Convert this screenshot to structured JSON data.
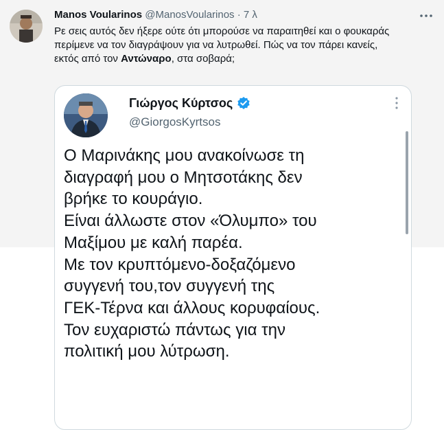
{
  "tweet": {
    "author_name": "Manos Voularinos",
    "handle": "@ManosVoularinos",
    "separator": "·",
    "time": "7 λ",
    "more_icon": "ellipsis-horizontal-icon",
    "text_line1": "Ρε σεις αυτός δεν ήξερε ούτε ότι μπορούσε να παραιτηθεί και ο φουκαράς",
    "text_line2": "περίμενε να τον διαγράψουν για να λυτρωθεί. Πώς να τον πάρει κανείς,",
    "text_line3_pre": "εκτός από τον ",
    "text_line3_bold": "Αντώναρο",
    "text_line3_post": ", στα σοβαρά;"
  },
  "quoted": {
    "name": "Γιώργος Κύρτσος",
    "handle": "@GiorgosKyrtsos",
    "verified_color": "#1d9bf0",
    "lines": [
      "Ο Μαρινάκης μου ανακοίνωσε τη",
      "διαγραφή μου ο Μητσοτάκης δεν",
      "βρήκε το κουράγιο.",
      "Είναι άλλωστε στον «Όλυμπο» του",
      "Μαξίμου με καλή παρέα.",
      "Με τον κρυπτόμενο-δοξαζόμενο",
      "συγγενή του,τον συγγενή της",
      "ΓΕΚ-Τέρνα και άλλους κορυφαίους.",
      "Τον ευχαριστώ πάντως για την",
      "πολιτική μου λύτρωση."
    ]
  }
}
